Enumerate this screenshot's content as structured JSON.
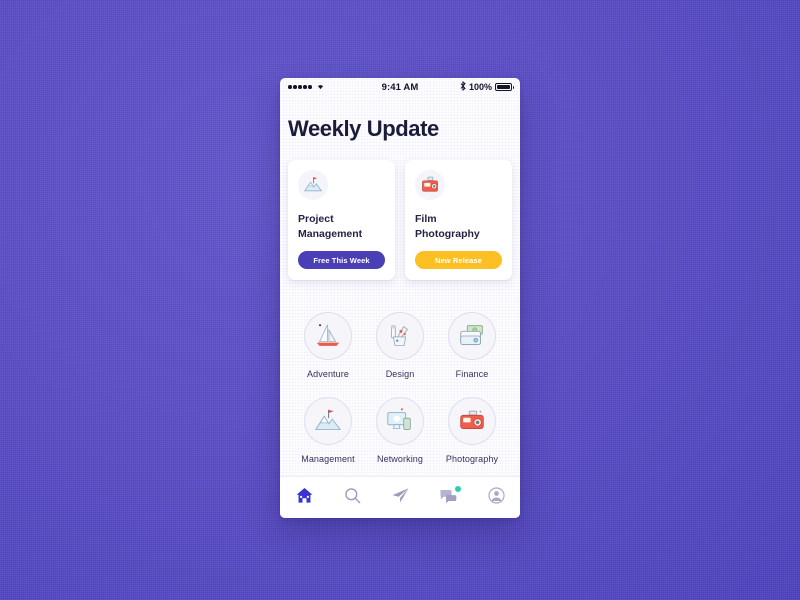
{
  "background": {
    "color": "#5a4ec6"
  },
  "phone": {
    "statusbar": {
      "signal_icon": "signal-dots-icon",
      "wifi_icon": "wifi-icon",
      "time": "9:41 AM",
      "bluetooth_icon": "bluetooth-icon",
      "battery_label": "100%",
      "battery_icon": "battery-full-icon"
    },
    "header": {
      "title": "Weekly Update"
    },
    "feature_cards": [
      {
        "icon": "mountain-flag-icon",
        "title": "Project\nManagement",
        "title_line1": "Project",
        "title_line2": "Management",
        "badge_label": "Free This Week",
        "badge_color": "#4a3fb5"
      },
      {
        "icon": "film-camera-icon",
        "title": "Film\nPhotography",
        "title_line1": "Film",
        "title_line2": "Photography",
        "badge_label": "New Release",
        "badge_color": "#fcc024"
      }
    ],
    "categories": [
      {
        "label": "Adventure",
        "icon": "sailboat-icon"
      },
      {
        "label": "Design",
        "icon": "pen-cup-icon"
      },
      {
        "label": "Finance",
        "icon": "wallet-money-icon"
      },
      {
        "label": "Management",
        "icon": "mountain-flag-icon"
      },
      {
        "label": "Networking",
        "icon": "monitor-devices-icon"
      },
      {
        "label": "Photography",
        "icon": "camera-icon"
      }
    ],
    "bottom_nav": [
      {
        "name": "home",
        "icon": "home-icon",
        "active": true,
        "badge": false,
        "color": "#3b32d0"
      },
      {
        "name": "search",
        "icon": "search-icon",
        "active": false,
        "badge": false,
        "color": "#9a9abf"
      },
      {
        "name": "send",
        "icon": "paper-plane-icon",
        "active": false,
        "badge": false,
        "color": "#9a9abf"
      },
      {
        "name": "chat",
        "icon": "chat-bubbles-icon",
        "active": false,
        "badge": true,
        "color": "#a9a9c8",
        "badge_color": "#2ad0b0"
      },
      {
        "name": "profile",
        "icon": "user-circle-icon",
        "active": false,
        "badge": false,
        "color": "#a9a9c8"
      }
    ]
  }
}
